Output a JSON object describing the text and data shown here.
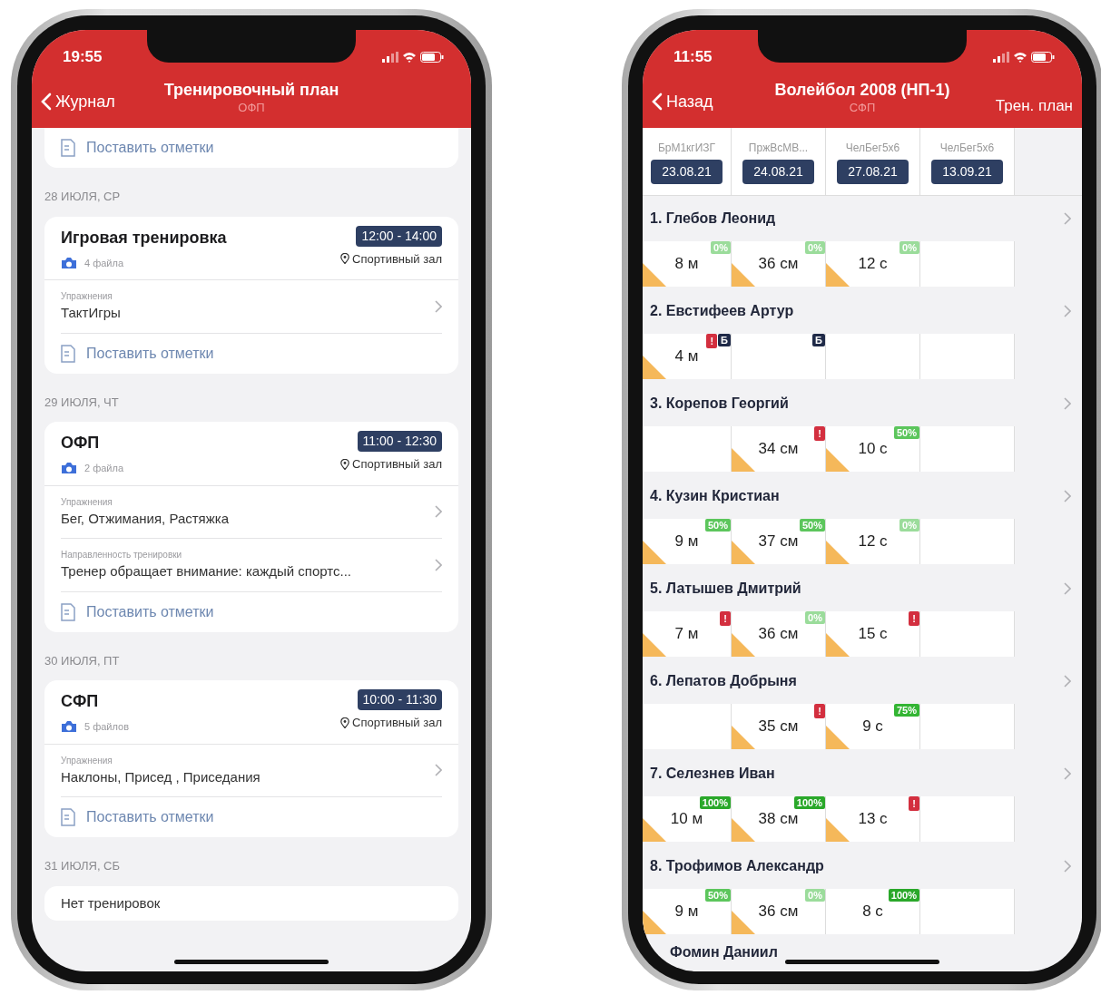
{
  "left_phone": {
    "status_time": "19:55",
    "nav": {
      "back": "Журнал",
      "title": "Тренировочный план",
      "subtitle": "ОФП"
    },
    "top_card": {
      "action": "Поставить отметки"
    },
    "days": [
      {
        "date": "28 ИЮЛЯ, СР",
        "trainings": [
          {
            "title": "Игровая тренировка",
            "files": "4 файла",
            "time": "12:00 - 14:00",
            "place": "Спортивный зал",
            "rows": [
              {
                "label": "Упражнения",
                "value": "ТактИгры"
              }
            ],
            "action": "Поставить отметки"
          }
        ]
      },
      {
        "date": "29 ИЮЛЯ, ЧТ",
        "trainings": [
          {
            "title": "ОФП",
            "files": "2 файла",
            "time": "11:00 - 12:30",
            "place": "Спортивный зал",
            "rows": [
              {
                "label": "Упражнения",
                "value": "Бег, Отжимания, Растяжка"
              },
              {
                "label": "Направленность тренировки",
                "value": "Тренер обращает внимание: каждый спортс..."
              }
            ],
            "action": "Поставить отметки"
          }
        ]
      },
      {
        "date": "30 ИЮЛЯ, ПТ",
        "trainings": [
          {
            "title": "СФП",
            "files": "5 файлов",
            "time": "10:00 - 11:30",
            "place": "Спортивный зал",
            "rows": [
              {
                "label": "Упражнения",
                "value": "Наклоны, Присед , Приседания"
              }
            ],
            "action": "Поставить отметки"
          }
        ]
      },
      {
        "date": "31 ИЮЛЯ, СБ",
        "empty_text": "Нет тренировок"
      }
    ]
  },
  "right_phone": {
    "status_time": "11:55",
    "nav": {
      "back": "Назад",
      "title": "Волейбол 2008 (НП-1)",
      "subtitle": "СФП",
      "action": "Трен. план"
    },
    "columns": [
      {
        "name": "БрМ1кгИЗГ",
        "date": "23.08.21"
      },
      {
        "name": "ПржВсМВ...",
        "date": "24.08.21"
      },
      {
        "name": "ЧелБег5х6",
        "date": "27.08.21"
      },
      {
        "name": "ЧелБег5х6",
        "date": "13.09.21"
      }
    ],
    "athletes": [
      {
        "name": "1. Глебов Леонид",
        "cells": [
          {
            "value": "8 м",
            "marked": true,
            "badges": [
              {
                "kind": "percent",
                "text": "0%",
                "color": "#9bdc9b"
              }
            ]
          },
          {
            "value": "36 см",
            "marked": true,
            "badges": [
              {
                "kind": "percent",
                "text": "0%",
                "color": "#9bdc9b"
              }
            ]
          },
          {
            "value": "12 с",
            "marked": true,
            "badges": [
              {
                "kind": "percent",
                "text": "0%",
                "color": "#9bdc9b"
              }
            ]
          },
          {
            "marked": false
          }
        ]
      },
      {
        "name": "2. Евстифеев Артур",
        "cells": [
          {
            "value": "4 м",
            "marked": true,
            "badges": [
              {
                "kind": "alert",
                "text": "!"
              },
              {
                "kind": "letter",
                "text": "Б"
              }
            ]
          },
          {
            "marked": false,
            "badges": [
              {
                "kind": "letter",
                "text": "Б"
              }
            ]
          },
          {
            "marked": false
          },
          {
            "marked": false
          }
        ]
      },
      {
        "name": "3. Корепов Георгий",
        "cells": [
          {
            "marked": false
          },
          {
            "value": "34 см",
            "marked": true,
            "badges": [
              {
                "kind": "alert",
                "text": "!"
              }
            ]
          },
          {
            "value": "10 с",
            "marked": true,
            "badges": [
              {
                "kind": "percent",
                "text": "50%",
                "color": "#5cc65c"
              }
            ]
          },
          {
            "marked": false
          }
        ]
      },
      {
        "name": "4. Кузин Кристиан",
        "cells": [
          {
            "value": "9 м",
            "marked": true,
            "badges": [
              {
                "kind": "percent",
                "text": "50%",
                "color": "#5cc65c"
              }
            ]
          },
          {
            "value": "37 см",
            "marked": true,
            "badges": [
              {
                "kind": "percent",
                "text": "50%",
                "color": "#5cc65c"
              }
            ]
          },
          {
            "value": "12 с",
            "marked": true,
            "badges": [
              {
                "kind": "percent",
                "text": "0%",
                "color": "#9bdc9b"
              }
            ]
          },
          {
            "marked": false
          }
        ]
      },
      {
        "name": "5. Латышев Дмитрий",
        "cells": [
          {
            "value": "7 м",
            "marked": true,
            "badges": [
              {
                "kind": "alert",
                "text": "!"
              }
            ]
          },
          {
            "value": "36 см",
            "marked": true,
            "badges": [
              {
                "kind": "percent",
                "text": "0%",
                "color": "#9bdc9b"
              }
            ]
          },
          {
            "value": "15 с",
            "marked": true,
            "badges": [
              {
                "kind": "alert",
                "text": "!"
              }
            ]
          },
          {
            "marked": false
          }
        ]
      },
      {
        "name": "6. Лепатов Добрыня",
        "cells": [
          {
            "marked": false
          },
          {
            "value": "35 см",
            "marked": true,
            "badges": [
              {
                "kind": "alert",
                "text": "!"
              }
            ]
          },
          {
            "value": "9 с",
            "marked": true,
            "badges": [
              {
                "kind": "percent",
                "text": "75%",
                "color": "#33b533"
              }
            ]
          },
          {
            "marked": false
          }
        ]
      },
      {
        "name": "7. Селезнев Иван",
        "cells": [
          {
            "value": "10 м",
            "marked": true,
            "badges": [
              {
                "kind": "percent",
                "text": "100%",
                "color": "#2aa82a"
              }
            ]
          },
          {
            "value": "38 см",
            "marked": true,
            "badges": [
              {
                "kind": "percent",
                "text": "100%",
                "color": "#2aa82a"
              }
            ]
          },
          {
            "value": "13 с",
            "marked": true,
            "badges": [
              {
                "kind": "alert",
                "text": "!"
              }
            ]
          },
          {
            "marked": false
          }
        ]
      },
      {
        "name": "8. Трофимов Александр",
        "cells": [
          {
            "value": "9 м",
            "marked": true,
            "badges": [
              {
                "kind": "percent",
                "text": "50%",
                "color": "#5cc65c"
              }
            ]
          },
          {
            "value": "36 см",
            "marked": true,
            "badges": [
              {
                "kind": "percent",
                "text": "0%",
                "color": "#9bdc9b"
              }
            ]
          },
          {
            "value": "8 с",
            "marked": false,
            "badges": [
              {
                "kind": "percent",
                "text": "100%",
                "color": "#2aa82a"
              }
            ]
          },
          {
            "marked": false
          }
        ]
      }
    ],
    "cut_row": "Фомин Даниил"
  }
}
